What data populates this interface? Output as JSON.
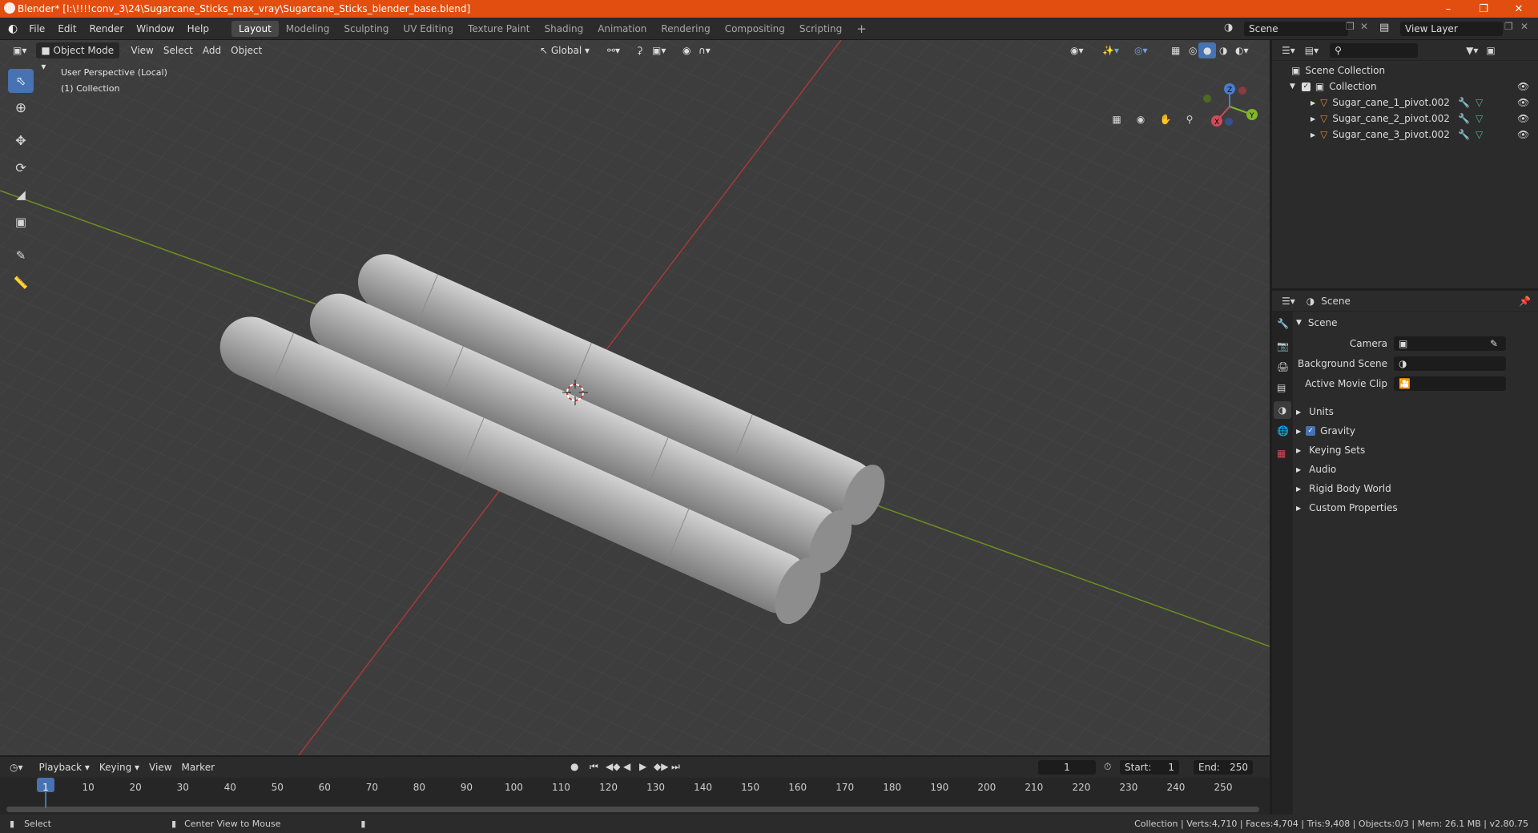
{
  "window": {
    "title": "Blender* [I:\\!!!!conv_3\\24\\Sugarcane_Sticks_max_vray\\Sugarcane_Sticks_blender_base.blend]"
  },
  "menu": [
    "File",
    "Edit",
    "Render",
    "Window",
    "Help"
  ],
  "workspaces": [
    "Layout",
    "Modeling",
    "Sculpting",
    "UV Editing",
    "Texture Paint",
    "Shading",
    "Animation",
    "Rendering",
    "Compositing",
    "Scripting"
  ],
  "active_workspace": "Layout",
  "scene_field": "Scene",
  "viewlayer_field": "View Layer",
  "viewport": {
    "mode": "Object Mode",
    "menus": [
      "View",
      "Select",
      "Add",
      "Object"
    ],
    "transform": "Global",
    "perspective": "User Perspective (Local)",
    "collection": "(1) Collection"
  },
  "outliner": {
    "root": "Scene Collection",
    "collection": "Collection",
    "objects": [
      "Sugar_cane_1_pivot.002",
      "Sugar_cane_2_pivot.002",
      "Sugar_cane_3_pivot.002"
    ]
  },
  "properties": {
    "header": "Scene",
    "section": "Scene",
    "fields": [
      {
        "label": "Camera"
      },
      {
        "label": "Background Scene"
      },
      {
        "label": "Active Movie Clip"
      }
    ],
    "subpanels": [
      "Units",
      "Gravity",
      "Keying Sets",
      "Audio",
      "Rigid Body World",
      "Custom Properties"
    ],
    "gravity_checked": true
  },
  "timeline": {
    "menus": [
      "Playback",
      "Keying",
      "View",
      "Marker"
    ],
    "current_frame": "1",
    "start_label": "Start:",
    "start": "1",
    "end_label": "End:",
    "end": "250",
    "ticks": [
      "1",
      "10",
      "20",
      "30",
      "40",
      "50",
      "60",
      "70",
      "80",
      "90",
      "100",
      "110",
      "120",
      "130",
      "140",
      "150",
      "160",
      "170",
      "180",
      "190",
      "200",
      "210",
      "220",
      "230",
      "240",
      "250"
    ]
  },
  "status": {
    "left": "Select",
    "middle": "Center View to Mouse",
    "right": "Collection | Verts:4,710 | Faces:4,704 | Tris:9,408 | Objects:0/3 | Mem: 26.1 MB | v2.80.75"
  },
  "colors": {
    "titlebar": "#e14e0f",
    "accent": "#4772b3",
    "x_axis": "#a8393d",
    "y_axis": "#6f8f1e",
    "object_orange": "#e0852e"
  }
}
